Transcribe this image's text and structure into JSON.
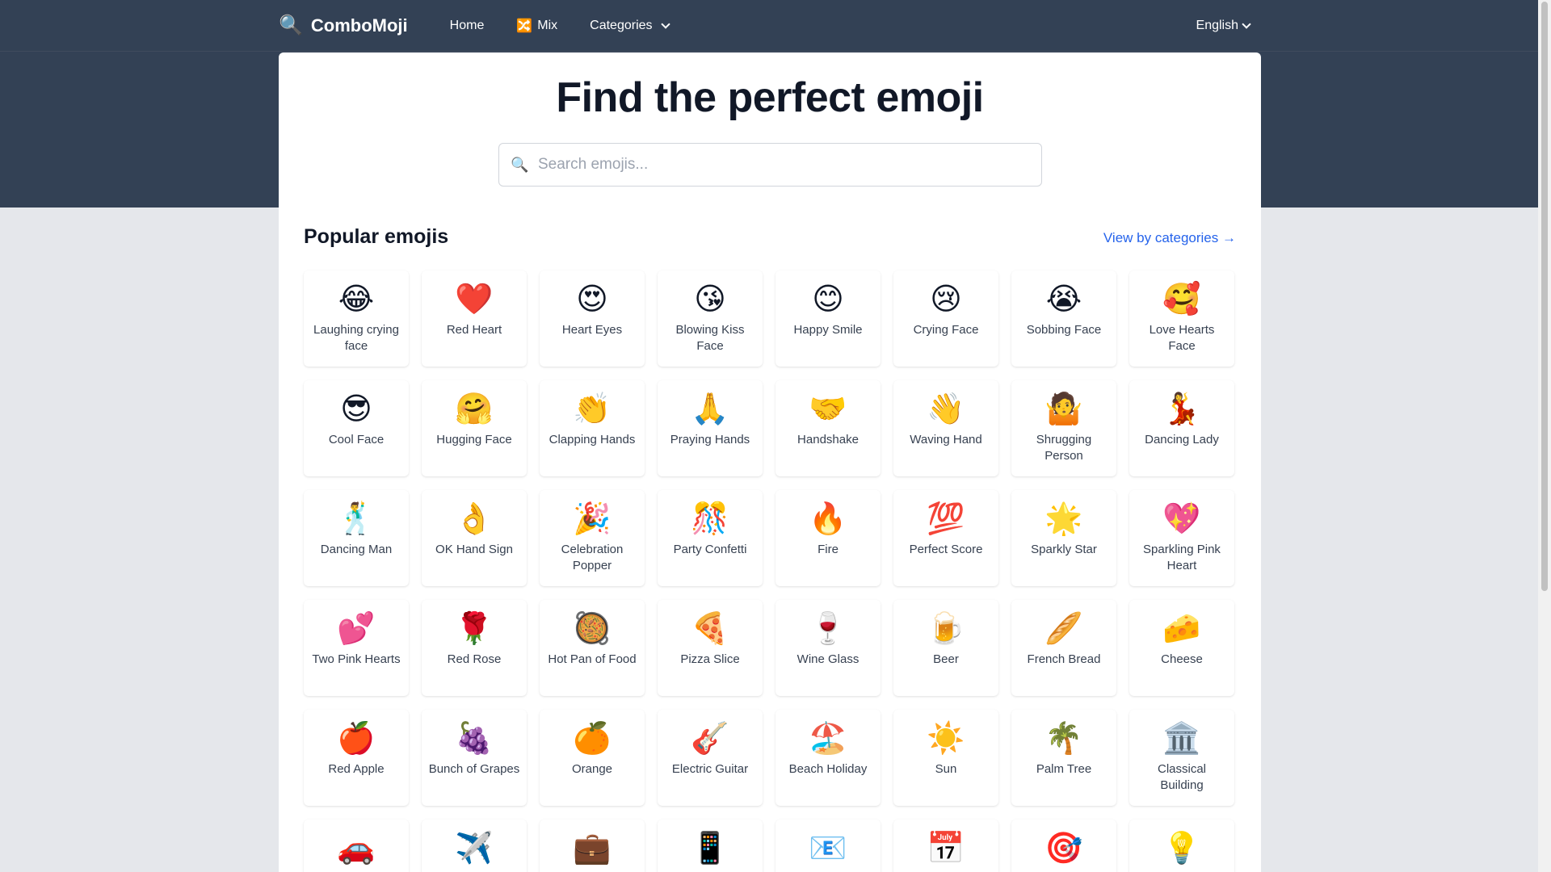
{
  "nav": {
    "brand_icon": "🔍",
    "brand": "ComboMoji",
    "home": "Home",
    "mix_icon": "🔀",
    "mix": "Mix",
    "categories": "Categories",
    "language": "English"
  },
  "hero": {
    "title": "Find the perfect emoji",
    "search_icon": "🔍",
    "search_placeholder": "Search emojis..."
  },
  "section": {
    "title": "Popular emojis",
    "view_link": "View by categories →"
  },
  "emojis": [
    {
      "e": "😂",
      "label": "Laughing crying face"
    },
    {
      "e": "❤️",
      "label": "Red Heart"
    },
    {
      "e": "😍",
      "label": "Heart Eyes"
    },
    {
      "e": "😘",
      "label": "Blowing Kiss Face"
    },
    {
      "e": "😊",
      "label": "Happy Smile"
    },
    {
      "e": "😢",
      "label": "Crying Face"
    },
    {
      "e": "😭",
      "label": "Sobbing Face"
    },
    {
      "e": "🥰",
      "label": "Love Hearts Face"
    },
    {
      "e": "😎",
      "label": "Cool Face"
    },
    {
      "e": "🤗",
      "label": "Hugging Face"
    },
    {
      "e": "👏",
      "label": "Clapping Hands"
    },
    {
      "e": "🙏",
      "label": "Praying Hands"
    },
    {
      "e": "🤝",
      "label": "Handshake"
    },
    {
      "e": "👋",
      "label": "Waving Hand"
    },
    {
      "e": "🤷",
      "label": "Shrugging Person"
    },
    {
      "e": "💃",
      "label": "Dancing Lady"
    },
    {
      "e": "🕺",
      "label": "Dancing Man"
    },
    {
      "e": "👌",
      "label": "OK Hand Sign"
    },
    {
      "e": "🎉",
      "label": "Celebration Popper"
    },
    {
      "e": "🎊",
      "label": "Party Confetti"
    },
    {
      "e": "🔥",
      "label": "Fire"
    },
    {
      "e": "💯",
      "label": "Perfect Score"
    },
    {
      "e": "🌟",
      "label": "Sparkly Star"
    },
    {
      "e": "💖",
      "label": "Sparkling Pink Heart"
    },
    {
      "e": "💕",
      "label": "Two Pink Hearts"
    },
    {
      "e": "🌹",
      "label": "Red Rose"
    },
    {
      "e": "🥘",
      "label": "Hot Pan of Food"
    },
    {
      "e": "🍕",
      "label": "Pizza Slice"
    },
    {
      "e": "🍷",
      "label": "Wine Glass"
    },
    {
      "e": "🍺",
      "label": "Beer"
    },
    {
      "e": "🥖",
      "label": "French Bread"
    },
    {
      "e": "🧀",
      "label": "Cheese"
    },
    {
      "e": "🍎",
      "label": "Red Apple"
    },
    {
      "e": "🍇",
      "label": "Bunch of Grapes"
    },
    {
      "e": "🍊",
      "label": "Orange"
    },
    {
      "e": "🎸",
      "label": "Electric Guitar"
    },
    {
      "e": "🏖️",
      "label": "Beach Holiday"
    },
    {
      "e": "☀️",
      "label": "Sun"
    },
    {
      "e": "🌴",
      "label": "Palm Tree"
    },
    {
      "e": "🏛️",
      "label": "Classical Building"
    },
    {
      "e": "🚗",
      "label": ""
    },
    {
      "e": "✈️",
      "label": ""
    },
    {
      "e": "💼",
      "label": ""
    },
    {
      "e": "📱",
      "label": ""
    },
    {
      "e": "📧",
      "label": ""
    },
    {
      "e": "📅",
      "label": ""
    },
    {
      "e": "🎯",
      "label": ""
    },
    {
      "e": "💡",
      "label": ""
    }
  ]
}
